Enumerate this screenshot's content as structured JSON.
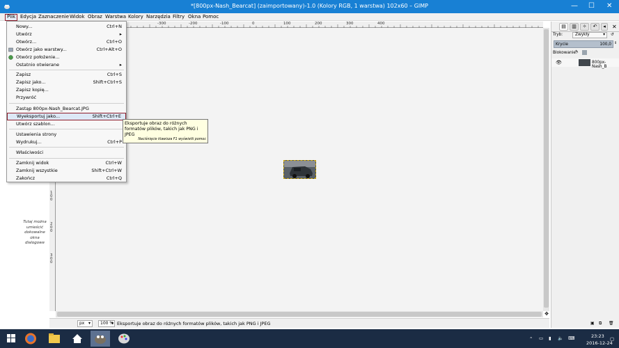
{
  "window": {
    "title": "*[800px-Nash_Bearcat] (zaimportowany)-1.0 (Kolory RGB, 1 warstwa) 102x60 – GIMP",
    "minimize": "—",
    "maximize": "☐",
    "close": "✕"
  },
  "menubar": {
    "items": [
      "Plik",
      "Edycja",
      "Zaznaczenie",
      "Widok",
      "Obraz",
      "Warstwa",
      "Kolory",
      "Narzędzia",
      "Filtry",
      "Okna",
      "Pomoc"
    ]
  },
  "file_menu": {
    "items": [
      {
        "label": "Nowy...",
        "shortcut": "Ctrl+N"
      },
      {
        "label": "Utwórz",
        "shortcut": "▸"
      },
      {
        "label": "Otwórz...",
        "shortcut": "Ctrl+O"
      },
      {
        "label": "Otwórz jako warstwy...",
        "shortcut": "Ctrl+Alt+O"
      },
      {
        "label": "Otwórz położenie...",
        "shortcut": ""
      },
      {
        "label": "Ostatnio otwierane",
        "shortcut": "▸"
      },
      {
        "label": "Zapisz",
        "shortcut": "Ctrl+S"
      },
      {
        "label": "Zapisz jako...",
        "shortcut": "Shift+Ctrl+S"
      },
      {
        "label": "Zapisz kopię...",
        "shortcut": ""
      },
      {
        "label": "Przywróć",
        "shortcut": ""
      },
      {
        "label": "Zastąp 800px-Nash_Bearcat.JPG",
        "shortcut": ""
      },
      {
        "label": "Wyeksportuj jako...",
        "shortcut": "Shift+Ctrl+E"
      },
      {
        "label": "Utwórz szablon...",
        "shortcut": ""
      },
      {
        "label": "Ustawienia strony",
        "shortcut": ""
      },
      {
        "label": "Wydrukuj...",
        "shortcut": "Ctrl+P"
      },
      {
        "label": "Właściwości",
        "shortcut": ""
      },
      {
        "label": "Zamknij widok",
        "shortcut": "Ctrl+W"
      },
      {
        "label": "Zamknij wszystkie",
        "shortcut": "Shift+Ctrl+W"
      },
      {
        "label": "Zakończ",
        "shortcut": "Ctrl+Q"
      }
    ]
  },
  "tooltip": {
    "text": "Eksportuje obraz do różnych formatów plików, takich jak PNG i JPEG",
    "hint": "Naciśnięcie klawisza F1 wyświetli pomoc"
  },
  "ruler": {
    "top_labels": [
      "-300",
      "-200",
      "-100",
      "0",
      "100",
      "200",
      "300",
      "400"
    ],
    "left_labels": [
      "100",
      "200",
      "300"
    ]
  },
  "canvas": {
    "dock_hint": "Tutaj można umieścić dokowalne okna dialogowe"
  },
  "statusbar": {
    "unit": "px",
    "zoom": "100 %",
    "message": "Eksportuje obraz do różnych formatów plików, takich jak PNG i JPEG"
  },
  "layers_panel": {
    "mode_label": "Tryb:",
    "mode_value": "Zwykły",
    "opacity_label": "Krycie",
    "opacity_value": "100,0",
    "opacity_fraction": 1.0,
    "lock_label": "Blokowanie:",
    "layer_name": "800px-Nash_B"
  },
  "taskbar": {
    "time": "23:23",
    "date": "2016-12-24"
  }
}
